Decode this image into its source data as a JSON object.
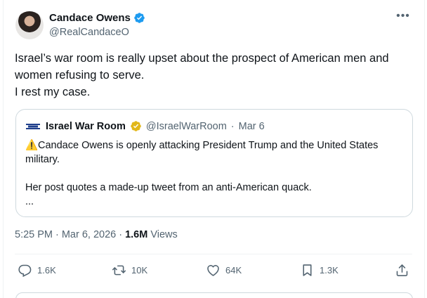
{
  "author": {
    "display_name": "Candace Owens",
    "handle": "@RealCandaceO",
    "verified_color": "#1d9bf0"
  },
  "tweet": {
    "lines": [
      "Israel’s war room is really upset about the prospect of American men and",
      "women refusing to serve.",
      "I rest my case."
    ]
  },
  "quote": {
    "name": "Israel War Room",
    "badge_color": "#e2b719",
    "handle": "@IsraelWarRoom",
    "separator": "·",
    "date": "Mar 6",
    "warning_emoji": "⚠️",
    "line1": "Candace Owens is openly attacking President Trump and the United States",
    "line2": "military.",
    "line3": "Her post quotes a made-up tweet from an anti-American quack.",
    "line4": "..."
  },
  "meta": {
    "time": "5:25 PM",
    "separator": "·",
    "date": "Mar 6, 2026",
    "views_count": "1.6M",
    "views_label": "Views"
  },
  "actions": {
    "reply_count": "1.6K",
    "repost_count": "10K",
    "like_count": "64K",
    "bookmark_count": "1.3K"
  },
  "icons": [
    "verified-badge-icon",
    "more-icon",
    "gold-badge-icon",
    "reply-icon",
    "repost-icon",
    "like-icon",
    "bookmark-icon",
    "share-icon"
  ]
}
